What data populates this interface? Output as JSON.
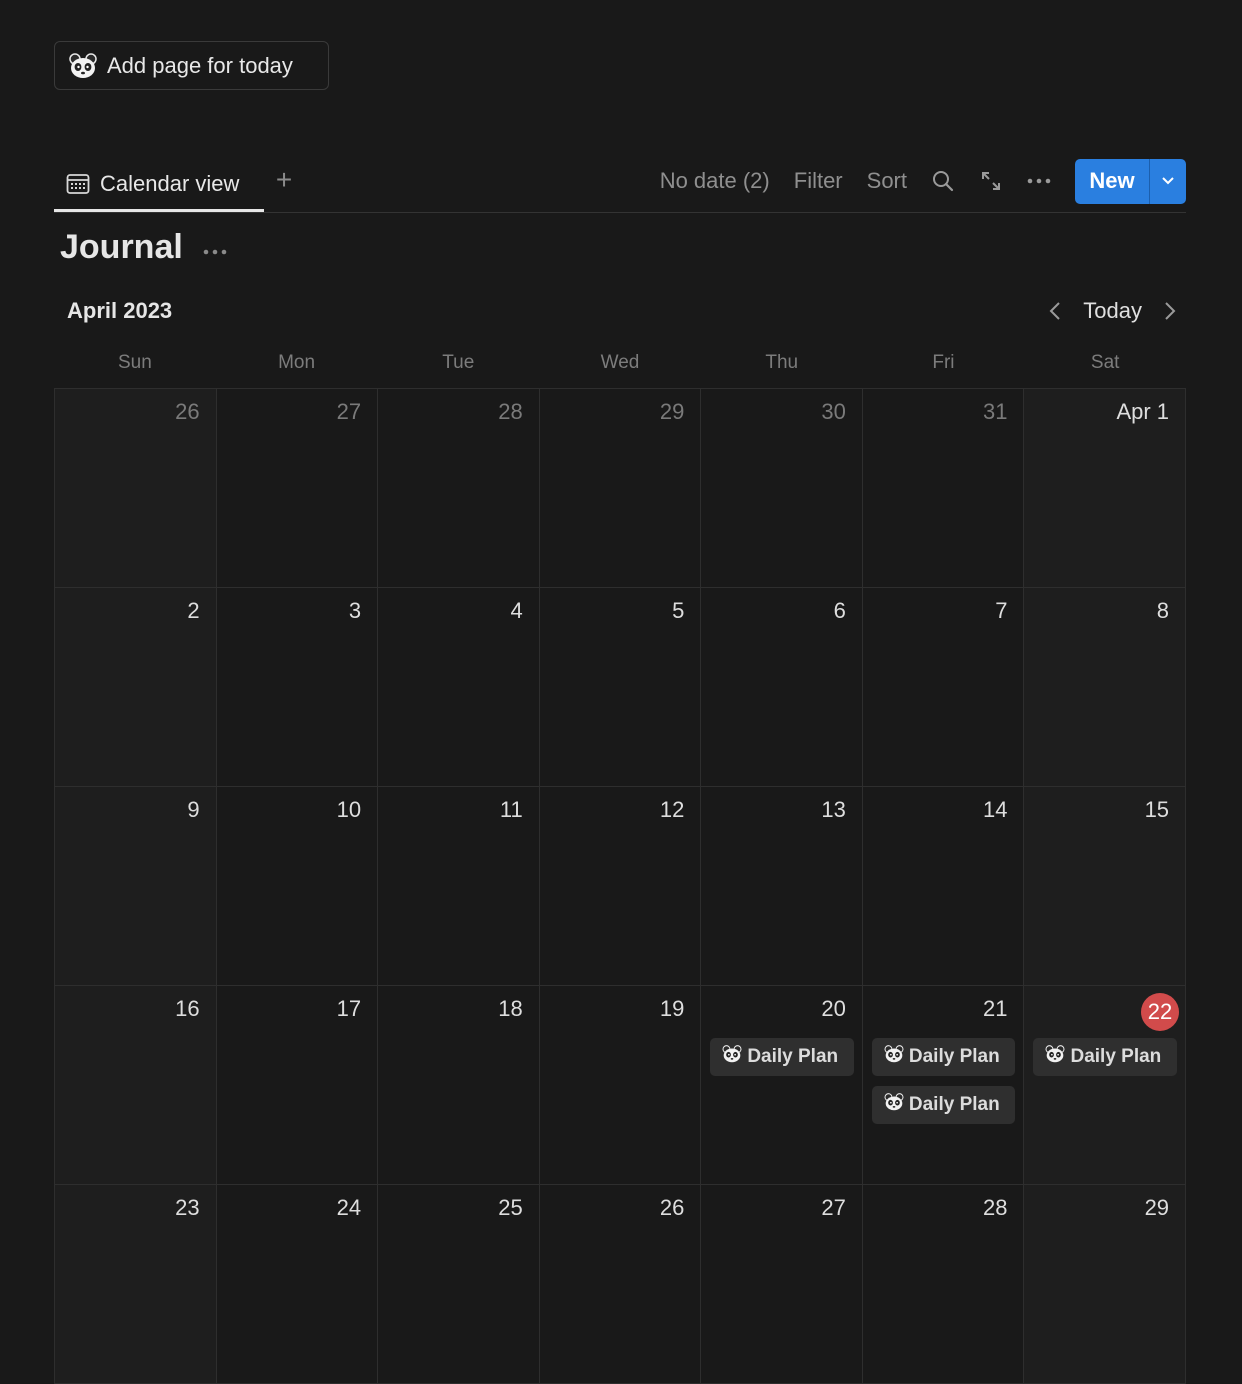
{
  "add_button": {
    "label": "Add page for today",
    "icon": "panda-icon"
  },
  "tabs": {
    "active_label": "Calendar view",
    "active_icon": "calendar-icon"
  },
  "toolbar": {
    "no_date": "No date (2)",
    "filter": "Filter",
    "sort": "Sort",
    "new_label": "New"
  },
  "database_title": "Journal",
  "calendar": {
    "month_label": "April 2023",
    "today_label": "Today",
    "weekdays": [
      "Sun",
      "Mon",
      "Tue",
      "Wed",
      "Thu",
      "Fri",
      "Sat"
    ],
    "weeks": [
      [
        {
          "label": "26",
          "out": true
        },
        {
          "label": "27",
          "out": true
        },
        {
          "label": "28",
          "out": true
        },
        {
          "label": "29",
          "out": true
        },
        {
          "label": "30",
          "out": true
        },
        {
          "label": "31",
          "out": true
        },
        {
          "label": "Apr 1"
        }
      ],
      [
        {
          "label": "2"
        },
        {
          "label": "3"
        },
        {
          "label": "4"
        },
        {
          "label": "5"
        },
        {
          "label": "6"
        },
        {
          "label": "7"
        },
        {
          "label": "8"
        }
      ],
      [
        {
          "label": "9"
        },
        {
          "label": "10"
        },
        {
          "label": "11"
        },
        {
          "label": "12"
        },
        {
          "label": "13"
        },
        {
          "label": "14"
        },
        {
          "label": "15"
        }
      ],
      [
        {
          "label": "16"
        },
        {
          "label": "17"
        },
        {
          "label": "18"
        },
        {
          "label": "19"
        },
        {
          "label": "20",
          "events": [
            "Daily Plan"
          ]
        },
        {
          "label": "21",
          "events": [
            "Daily Plan",
            "Daily Plan"
          ]
        },
        {
          "label": "22",
          "today": true,
          "events": [
            "Daily Plan"
          ]
        }
      ],
      [
        {
          "label": "23"
        },
        {
          "label": "24"
        },
        {
          "label": "25"
        },
        {
          "label": "26"
        },
        {
          "label": "27"
        },
        {
          "label": "28"
        },
        {
          "label": "29"
        }
      ]
    ]
  },
  "colors": {
    "background": "#191919",
    "accent_blue": "#2a7fe0",
    "today_red": "#d14b4b",
    "card": "#2f2f2f"
  }
}
